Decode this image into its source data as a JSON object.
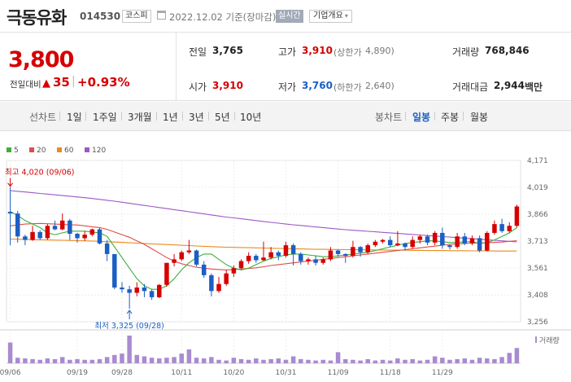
{
  "header": {
    "stock_name": "극동유화",
    "stock_code": "014530",
    "market_badge": "코스피",
    "date_text": "2022.12.02 기준(장마감)",
    "realtime_btn": "실시간",
    "company_btn": "기업개요"
  },
  "quote": {
    "price": "3,800",
    "change_label": "전일대비",
    "change_arrow": "▲",
    "change_value": "35",
    "change_sep": "|",
    "change_pct": "+0.93%",
    "prev_close_label": "전일",
    "prev_close": "3,765",
    "high_label": "고가",
    "high": "3,910",
    "upper_limit_label": "(상한가",
    "upper_limit": "4,890)",
    "volume_label": "거래량",
    "volume": "768,846",
    "open_label": "시가",
    "open": "3,910",
    "low_label": "저가",
    "low": "3,760",
    "lower_limit_label": "(하한가",
    "lower_limit": "2,640)",
    "amount_label": "거래대금",
    "amount": "2,944",
    "amount_unit": "백만"
  },
  "tabs": {
    "line_chart_label": "선차트",
    "line_periods": [
      "1일",
      "1주일",
      "3개월",
      "1년",
      "3년",
      "5년",
      "10년"
    ],
    "candle_chart_label": "봉차트",
    "candle_periods": [
      "일봉",
      "주봉",
      "월봉"
    ],
    "active_candle": "일봉"
  },
  "colors": {
    "up": "#d60000",
    "down": "#1b5fc4",
    "ma5": "#3fae3a",
    "ma20": "#e04b4b",
    "ma60": "#e98b1d",
    "ma120": "#9b59c4",
    "volume": "#a98bd0"
  },
  "chart_data": {
    "type": "candlestick",
    "legend": [
      {
        "name": "5",
        "icon": "green-square"
      },
      {
        "name": "20",
        "icon": "red-square"
      },
      {
        "name": "60",
        "icon": "orange-square"
      },
      {
        "name": "120",
        "icon": "purple-square"
      }
    ],
    "y_ticks": [
      "4,171",
      "4,019",
      "3,866",
      "3,713",
      "3,561",
      "3,408",
      "3,256"
    ],
    "ylim": [
      3256,
      4171
    ],
    "x_ticks": [
      {
        "idx": 0,
        "label": "09/06"
      },
      {
        "idx": 9,
        "label": "09/19"
      },
      {
        "idx": 15,
        "label": "09/28"
      },
      {
        "idx": 23,
        "label": "10/11"
      },
      {
        "idx": 30,
        "label": "10/20"
      },
      {
        "idx": 37,
        "label": "10/31"
      },
      {
        "idx": 44,
        "label": "11/09"
      },
      {
        "idx": 51,
        "label": "11/18"
      },
      {
        "idx": 58,
        "label": "11/29"
      }
    ],
    "candles": [
      [
        3880,
        3870,
        4020,
        3690
      ],
      [
        3870,
        3740,
        3885,
        3705
      ],
      [
        3740,
        3720,
        3750,
        3690
      ],
      [
        3720,
        3765,
        3800,
        3715
      ],
      [
        3765,
        3730,
        3775,
        3720
      ],
      [
        3730,
        3800,
        3810,
        3720
      ],
      [
        3800,
        3780,
        3830,
        3775
      ],
      [
        3780,
        3830,
        3870,
        3775
      ],
      [
        3830,
        3755,
        3840,
        3720
      ],
      [
        3755,
        3730,
        3760,
        3705
      ],
      [
        3730,
        3750,
        3770,
        3715
      ],
      [
        3750,
        3780,
        3785,
        3740
      ],
      [
        3780,
        3700,
        3790,
        3695
      ],
      [
        3700,
        3640,
        3720,
        3600
      ],
      [
        3640,
        3450,
        3640,
        3440
      ],
      [
        3450,
        3440,
        3480,
        3420
      ],
      [
        3440,
        3420,
        3460,
        3330
      ],
      [
        3420,
        3450,
        3480,
        3400
      ],
      [
        3450,
        3430,
        3470,
        3395
      ],
      [
        3430,
        3395,
        3440,
        3380
      ],
      [
        3395,
        3465,
        3470,
        3390
      ],
      [
        3465,
        3590,
        3590,
        3455
      ],
      [
        3590,
        3610,
        3640,
        3570
      ],
      [
        3610,
        3650,
        3660,
        3600
      ],
      [
        3650,
        3660,
        3720,
        3640
      ],
      [
        3660,
        3580,
        3665,
        3570
      ],
      [
        3580,
        3520,
        3600,
        3505
      ],
      [
        3520,
        3430,
        3530,
        3400
      ],
      [
        3430,
        3470,
        3510,
        3420
      ],
      [
        3470,
        3530,
        3550,
        3460
      ],
      [
        3530,
        3560,
        3575,
        3510
      ],
      [
        3560,
        3600,
        3610,
        3555
      ],
      [
        3600,
        3630,
        3650,
        3585
      ],
      [
        3630,
        3605,
        3640,
        3590
      ],
      [
        3605,
        3620,
        3710,
        3600
      ],
      [
        3620,
        3650,
        3680,
        3610
      ],
      [
        3650,
        3630,
        3660,
        3605
      ],
      [
        3630,
        3690,
        3710,
        3620
      ],
      [
        3690,
        3640,
        3700,
        3575
      ],
      [
        3640,
        3600,
        3650,
        3580
      ],
      [
        3600,
        3610,
        3620,
        3580
      ],
      [
        3610,
        3590,
        3630,
        3575
      ],
      [
        3590,
        3610,
        3620,
        3580
      ],
      [
        3610,
        3660,
        3680,
        3600
      ],
      [
        3660,
        3640,
        3665,
        3625
      ],
      [
        3640,
        3630,
        3645,
        3590
      ],
      [
        3630,
        3680,
        3715,
        3620
      ],
      [
        3680,
        3650,
        3685,
        3625
      ],
      [
        3650,
        3690,
        3700,
        3640
      ],
      [
        3690,
        3710,
        3720,
        3680
      ],
      [
        3710,
        3720,
        3725,
        3700
      ],
      [
        3720,
        3690,
        3740,
        3680
      ],
      [
        3690,
        3700,
        3770,
        3685
      ],
      [
        3700,
        3680,
        3705,
        3660
      ],
      [
        3680,
        3720,
        3740,
        3670
      ],
      [
        3720,
        3740,
        3750,
        3700
      ],
      [
        3740,
        3705,
        3750,
        3690
      ],
      [
        3705,
        3760,
        3770,
        3690
      ],
      [
        3760,
        3690,
        3790,
        3670
      ],
      [
        3690,
        3680,
        3695,
        3665
      ],
      [
        3680,
        3740,
        3760,
        3670
      ],
      [
        3740,
        3700,
        3760,
        3690
      ],
      [
        3700,
        3730,
        3745,
        3690
      ],
      [
        3730,
        3660,
        3745,
        3650
      ],
      [
        3660,
        3760,
        3770,
        3655
      ],
      [
        3760,
        3810,
        3830,
        3750
      ],
      [
        3810,
        3770,
        3840,
        3760
      ],
      [
        3770,
        3800,
        3820,
        3760
      ],
      [
        3800,
        3910,
        3920,
        3790
      ]
    ],
    "ma5": [
      3880,
      3860,
      3830,
      3810,
      3790,
      3760,
      3750,
      3760,
      3770,
      3770,
      3770,
      3765,
      3760,
      3740,
      3680,
      3620,
      3560,
      3500,
      3460,
      3440,
      3440,
      3460,
      3500,
      3550,
      3590,
      3620,
      3640,
      3640,
      3610,
      3580,
      3560,
      3550,
      3560,
      3580,
      3600,
      3615,
      3625,
      3635,
      3640,
      3640,
      3635,
      3630,
      3625,
      3625,
      3630,
      3635,
      3640,
      3645,
      3650,
      3660,
      3670,
      3680,
      3690,
      3700,
      3705,
      3710,
      3715,
      3715,
      3710,
      3705,
      3705,
      3710,
      3710,
      3700,
      3705,
      3720,
      3740,
      3760,
      3790
    ],
    "ma20": [
      3800,
      3805,
      3810,
      3812,
      3814,
      3812,
      3810,
      3808,
      3806,
      3805,
      3800,
      3795,
      3790,
      3780,
      3765,
      3750,
      3735,
      3715,
      3695,
      3670,
      3645,
      3620,
      3600,
      3585,
      3575,
      3565,
      3560,
      3555,
      3552,
      3550,
      3552,
      3555,
      3558,
      3562,
      3568,
      3575,
      3580,
      3585,
      3590,
      3595,
      3600,
      3605,
      3610,
      3615,
      3620,
      3625,
      3630,
      3635,
      3640,
      3645,
      3650,
      3655,
      3660,
      3665,
      3670,
      3675,
      3680,
      3685,
      3690,
      3695,
      3698,
      3700,
      3702,
      3703,
      3704,
      3706,
      3708,
      3712,
      3716
    ],
    "ma60": [
      3725,
      3724,
      3723,
      3722,
      3721,
      3720,
      3719,
      3718,
      3717,
      3716,
      3715,
      3714,
      3712,
      3710,
      3708,
      3706,
      3704,
      3702,
      3700,
      3698,
      3696,
      3694,
      3692,
      3690,
      3688,
      3686,
      3684,
      3682,
      3680,
      3679,
      3678,
      3677,
      3676,
      3675,
      3674,
      3673,
      3672,
      3671,
      3670,
      3669,
      3668,
      3667,
      3667,
      3666,
      3666,
      3665,
      3665,
      3664,
      3664,
      3663,
      3663,
      3662,
      3662,
      3662,
      3661,
      3661,
      3660,
      3660,
      3660,
      3659,
      3659,
      3659,
      3658,
      3658,
      3658,
      3657,
      3657,
      3657,
      3657
    ],
    "ma120": [
      4000,
      3996,
      3992,
      3988,
      3984,
      3980,
      3976,
      3972,
      3968,
      3964,
      3960,
      3955,
      3950,
      3945,
      3940,
      3934,
      3928,
      3922,
      3916,
      3910,
      3904,
      3898,
      3892,
      3886,
      3880,
      3874,
      3868,
      3862,
      3856,
      3850,
      3845,
      3840,
      3835,
      3830,
      3825,
      3820,
      3815,
      3810,
      3806,
      3802,
      3798,
      3794,
      3790,
      3786,
      3782,
      3778,
      3775,
      3772,
      3769,
      3766,
      3763,
      3760,
      3757,
      3754,
      3751,
      3748,
      3745,
      3742,
      3739,
      3736,
      3733,
      3730,
      3727,
      3724,
      3721,
      3718,
      3715,
      3712,
      3709
    ],
    "volumes": [
      30,
      8,
      7,
      6,
      5,
      7,
      6,
      9,
      5,
      6,
      5,
      5,
      6,
      9,
      12,
      14,
      40,
      12,
      10,
      8,
      7,
      8,
      9,
      14,
      20,
      8,
      7,
      9,
      5,
      4,
      8,
      6,
      5,
      7,
      5,
      6,
      7,
      5,
      10,
      6,
      5,
      4,
      5,
      4,
      16,
      6,
      5,
      4,
      6,
      4,
      5,
      4,
      7,
      5,
      6,
      4,
      5,
      10,
      8,
      5,
      6,
      7,
      5,
      8,
      7,
      6,
      9,
      15,
      22
    ],
    "volume_label": "거래량",
    "annotations": {
      "high_label": "최고 4,020 (09/06)",
      "high_value": 4020,
      "high_idx": 0,
      "low_label": "최저 3,325 (09/28)",
      "low_value": 3325,
      "low_idx": 16
    }
  }
}
